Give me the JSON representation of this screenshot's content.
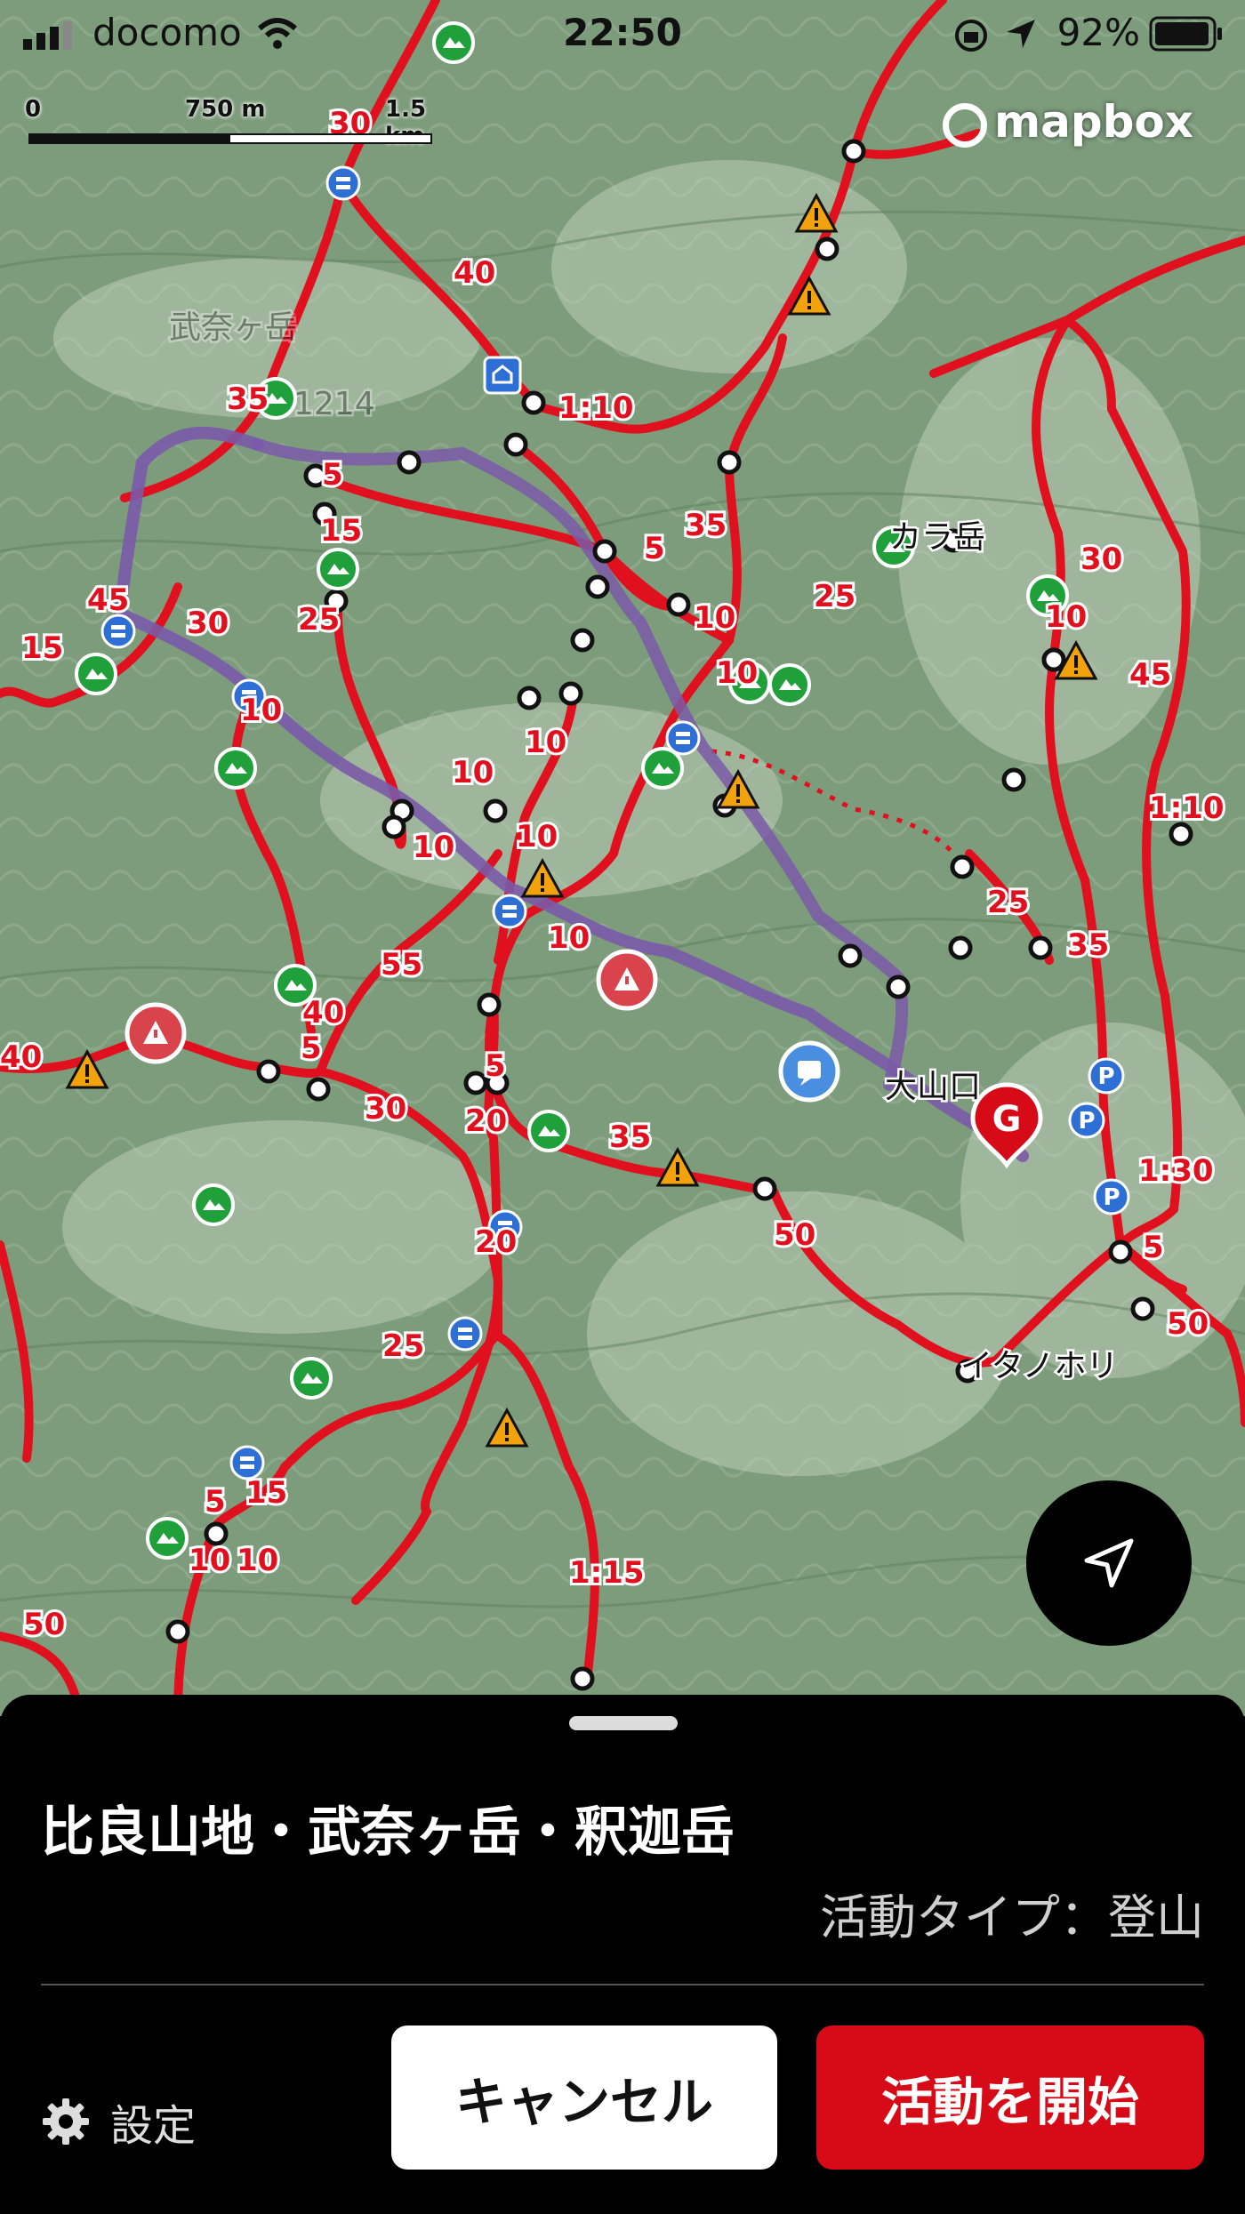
{
  "status_bar": {
    "carrier": "docomo",
    "time": "22:50",
    "battery": "92%"
  },
  "map": {
    "scale": {
      "start": "0",
      "mid": "750 m",
      "end": "1.5 km"
    },
    "attribution": "mapbox",
    "place_labels": [
      "カラ岳",
      "大山口",
      "イタノホリ",
      "武奈ヶ岳",
      "1214"
    ],
    "time_labels": [
      "30",
      "40",
      "1:10",
      "35",
      "25",
      "5",
      "15",
      "45",
      "10",
      "55",
      "50",
      "20",
      "1:30",
      "1:15",
      "1:10"
    ],
    "goal_marker": "G",
    "colors": {
      "trail": "#e0101e",
      "route": "#7a5aa8",
      "bg": "#7a9a7a"
    }
  },
  "sheet": {
    "title": "比良山地・武奈ヶ岳・釈迦岳",
    "activity_type": "活動タイプ：登山",
    "settings_label": "設定",
    "cancel_label": "キャンセル",
    "start_label": "活動を開始",
    "colors": {
      "start": "#d70b18",
      "cancel_bg": "#ffffff"
    }
  }
}
